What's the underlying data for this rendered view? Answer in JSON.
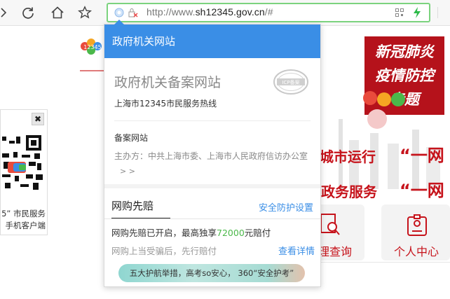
{
  "browser": {
    "url_prefix": "http://www.",
    "url_domain": "sh12345.gov.cn",
    "url_suffix": "/#"
  },
  "page": {
    "banner_line1": "新冠肺炎",
    "banner_line2": "疫情防控",
    "banner_line3": "专题",
    "hero_line1": "城市运行",
    "hero_line2": "政务服务",
    "hero_quote1": "“一网",
    "hero_quote2": "“一网",
    "tile1_label": "理查询",
    "tile2_label": "个人中心",
    "qr_caption_line1": "5” 市民服务",
    "qr_caption_line2": "手机客户端",
    "qr_close": "✖",
    "logo_text": "12345"
  },
  "popup": {
    "title": "政府机关网站",
    "record_title": "政府机关备案网站",
    "record_subtitle": "上海市12345市民服务热线",
    "stamp_text": "ICP备案",
    "filing_title": "备案网站",
    "filing_org": "主办方：中共上海市委、上海市人民政府信访办公室",
    "filing_more": "> >",
    "tab_label": "网购先赔",
    "settings_link": "安全防护设置",
    "compensation_prefix": "网购先赔已开启，最高独享",
    "compensation_amount": "72000",
    "compensation_suffix": "元赔付",
    "fraud_text": "网购上当受骗后，先行赔付",
    "detail_link": "查看详情",
    "ad_text": "五大护航举措，高考so安心， 360“安全护考”"
  },
  "colors": {
    "address_border": "#7bd37e",
    "popup_header": "#3a8ee6",
    "banner_red": "#b5121b",
    "link_blue": "#3a8ee6",
    "amount_green": "#4bb84a"
  }
}
